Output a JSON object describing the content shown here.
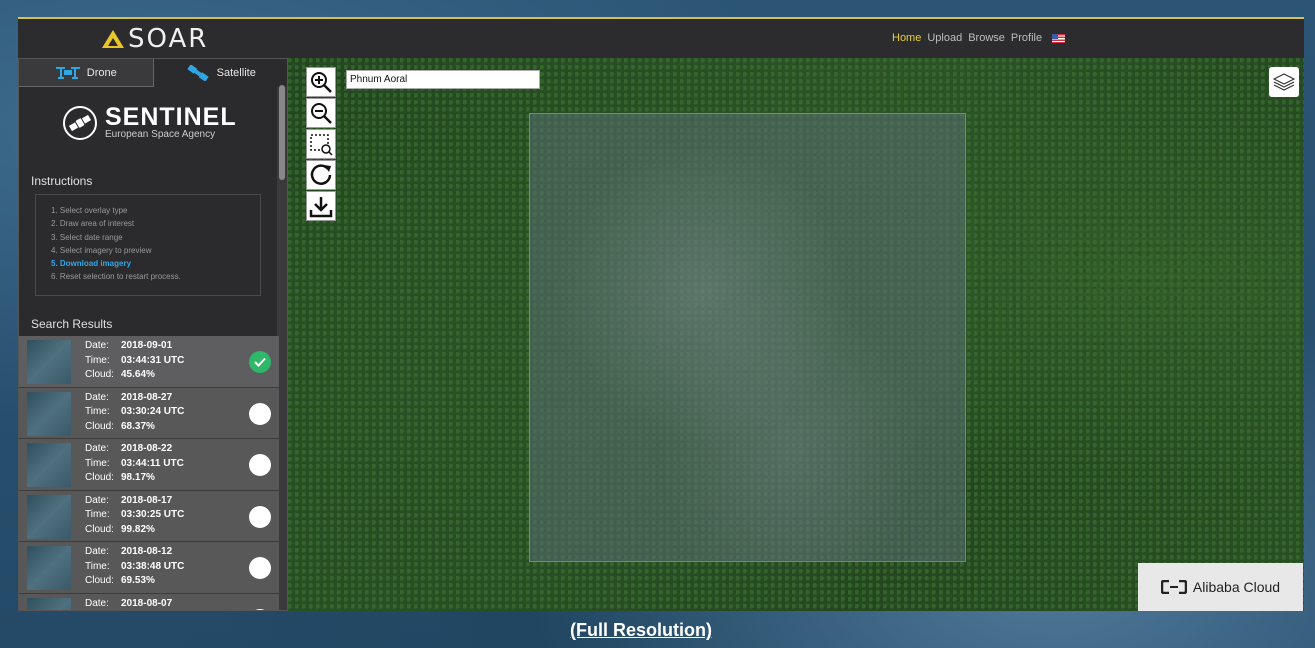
{
  "brand": {
    "name": "SOAR"
  },
  "nav": {
    "items": [
      "Home",
      "Upload",
      "Browse",
      "Profile"
    ],
    "active": "Home"
  },
  "tabs": {
    "drone": "Drone",
    "satellite": "Satellite"
  },
  "provider": {
    "title": "SENTINEL",
    "subtitle": "European Space Agency"
  },
  "instructions": {
    "heading": "Instructions",
    "steps": [
      "1. Select overlay type",
      "2. Draw area of interest",
      "3. Select date range",
      "4. Select imagery to preview",
      "5. Download imagery",
      "6. Reset selection to restart process."
    ],
    "highlighted_index": 4
  },
  "results": {
    "heading": "Search Results",
    "labels": {
      "date": "Date:",
      "time": "Time:",
      "cloud": "Cloud:"
    },
    "items": [
      {
        "date": "2018-09-01",
        "time": "03:44:31 UTC",
        "cloud": "45.64%",
        "selected": true
      },
      {
        "date": "2018-08-27",
        "time": "03:30:24 UTC",
        "cloud": "68.37%",
        "selected": false
      },
      {
        "date": "2018-08-22",
        "time": "03:44:11 UTC",
        "cloud": "98.17%",
        "selected": false
      },
      {
        "date": "2018-08-17",
        "time": "03:30:25 UTC",
        "cloud": "99.82%",
        "selected": false
      },
      {
        "date": "2018-08-12",
        "time": "03:38:48 UTC",
        "cloud": "69.53%",
        "selected": false
      },
      {
        "date": "2018-08-07",
        "time": "",
        "cloud": "",
        "selected": false
      }
    ]
  },
  "map": {
    "search_value": "Phnum Aoral"
  },
  "sponsor": {
    "name": "Alibaba Cloud"
  },
  "footer": {
    "link": "(Full Resolution)"
  },
  "colors": {
    "accent": "#e7d033",
    "highlight": "#2fa7e4",
    "check": "#2db86a"
  }
}
